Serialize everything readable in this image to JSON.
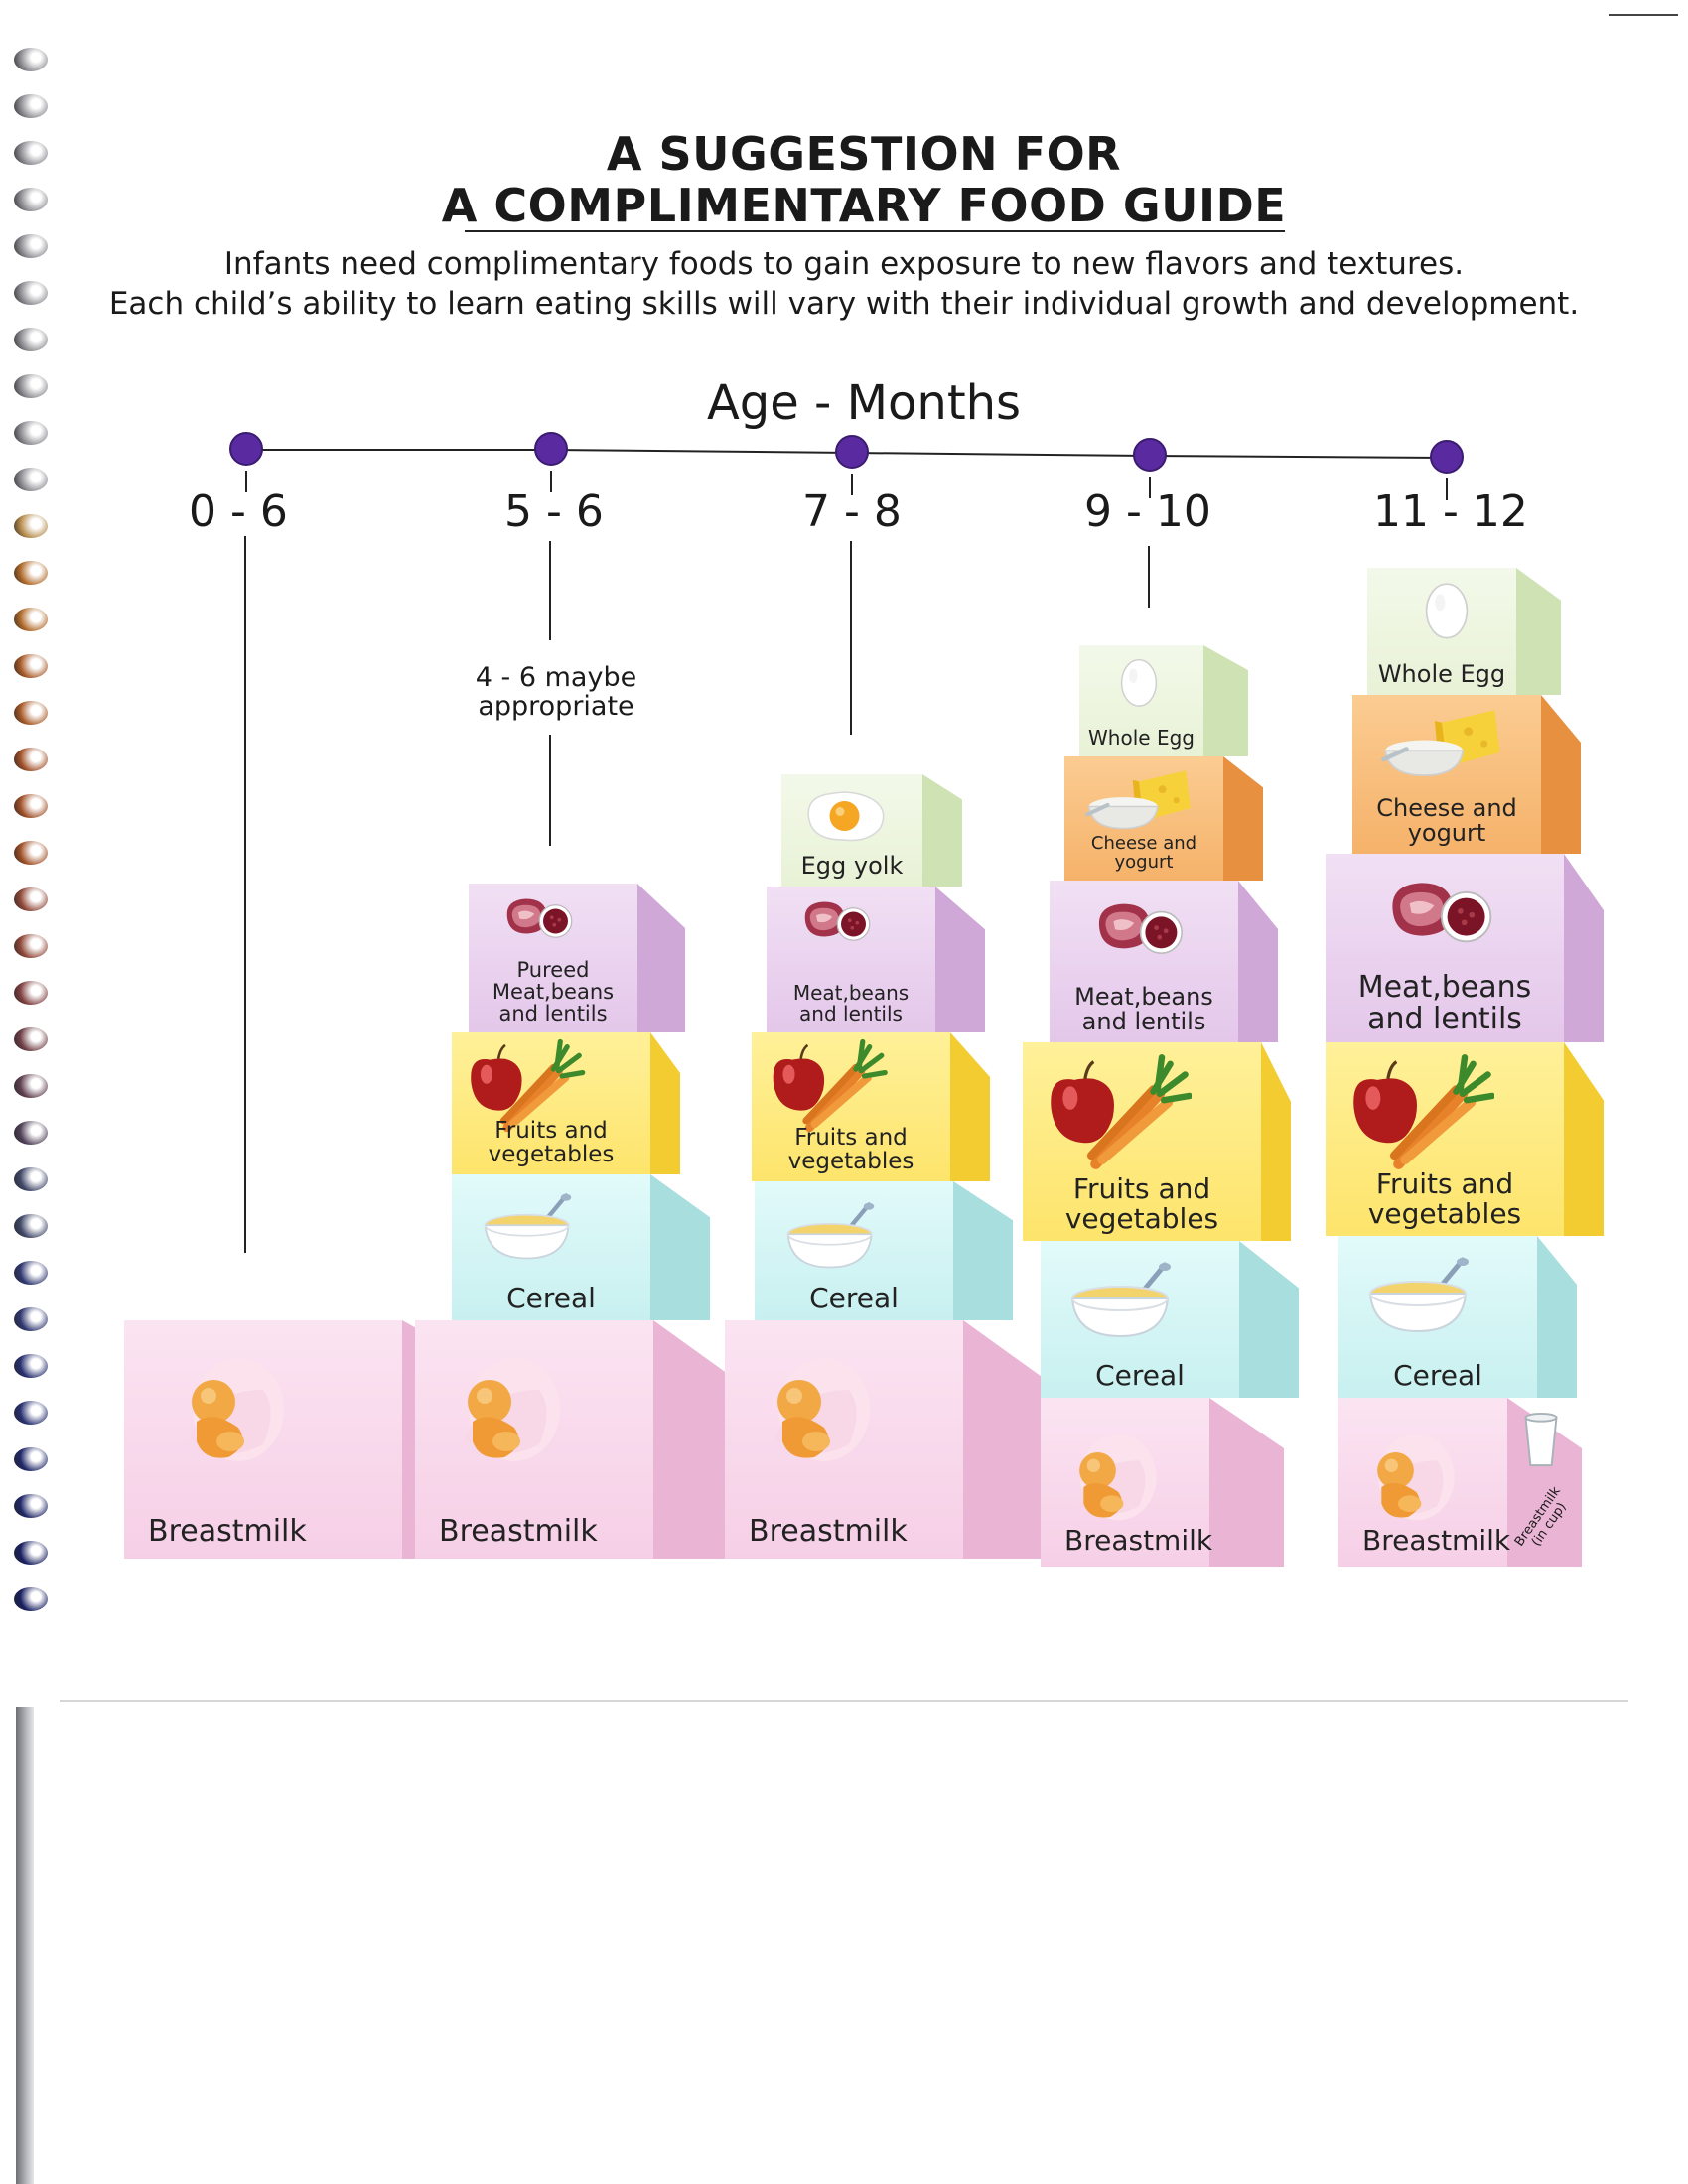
{
  "header": {
    "title_line1": "A SUGGESTION FOR",
    "title_line2": "A COMPLIMENTARY FOOD GUIDE",
    "intro_line1": "Infants need complimentary foods to gain exposure to new flavors and textures.",
    "intro_line2": "Each child’s ability to learn eating skills will vary with their individual growth and development."
  },
  "timeline": {
    "title": "Age - Months",
    "ages": [
      "0 - 6",
      "5 - 6",
      "7 - 8",
      "9 - 10",
      "11 - 12"
    ],
    "note": "4 - 6 maybe appropriate"
  },
  "food_labels": {
    "breastmilk": "Breastmilk",
    "cereal": "Cereal",
    "fruits": "Fruits and vegetables",
    "pureed_meat": "Pureed Meat,beans and lentils",
    "meat": "Meat,beans and lentils",
    "egg_yolk": "Egg yolk",
    "cheese": "Cheese and yogurt",
    "whole_egg": "Whole Egg",
    "breastmilk_cup": "Breastmilk (in cup)"
  },
  "stacks": [
    {
      "age": "0 - 6",
      "foods": [
        "Breastmilk"
      ]
    },
    {
      "age": "5 - 6",
      "foods": [
        "Breastmilk",
        "Cereal",
        "Fruits and vegetables",
        "Pureed Meat,beans and lentils"
      ]
    },
    {
      "age": "7 - 8",
      "foods": [
        "Breastmilk",
        "Cereal",
        "Fruits and vegetables",
        "Meat,beans and lentils",
        "Egg yolk"
      ]
    },
    {
      "age": "9 - 10",
      "foods": [
        "Breastmilk",
        "Cereal",
        "Fruits and vegetables",
        "Meat,beans and lentils",
        "Cheese and yogurt",
        "Whole Egg"
      ]
    },
    {
      "age": "11 - 12",
      "foods": [
        "Breastmilk",
        "Cereal",
        "Fruits and vegetables",
        "Meat,beans and lentils",
        "Cheese and yogurt",
        "Whole Egg"
      ]
    }
  ],
  "colors": {
    "breastmilk": "#f6cfe6",
    "cereal": "#c8f0f0",
    "fruits": "#fde46b",
    "meat": "#e4c7ea",
    "egg": "#e8f2d6",
    "cheese": "#f5b26a",
    "dot": "#5a2aa0"
  },
  "icons": {
    "breastmilk": "nursing-baby-icon",
    "cereal": "cereal-bowl-icon",
    "fruits": "apple-carrot-icon",
    "meat": "meat-beans-icon",
    "egg_yolk": "fried-egg-icon",
    "cheese": "cheese-yogurt-icon",
    "whole_egg": "egg-icon",
    "cup": "cup-icon"
  }
}
